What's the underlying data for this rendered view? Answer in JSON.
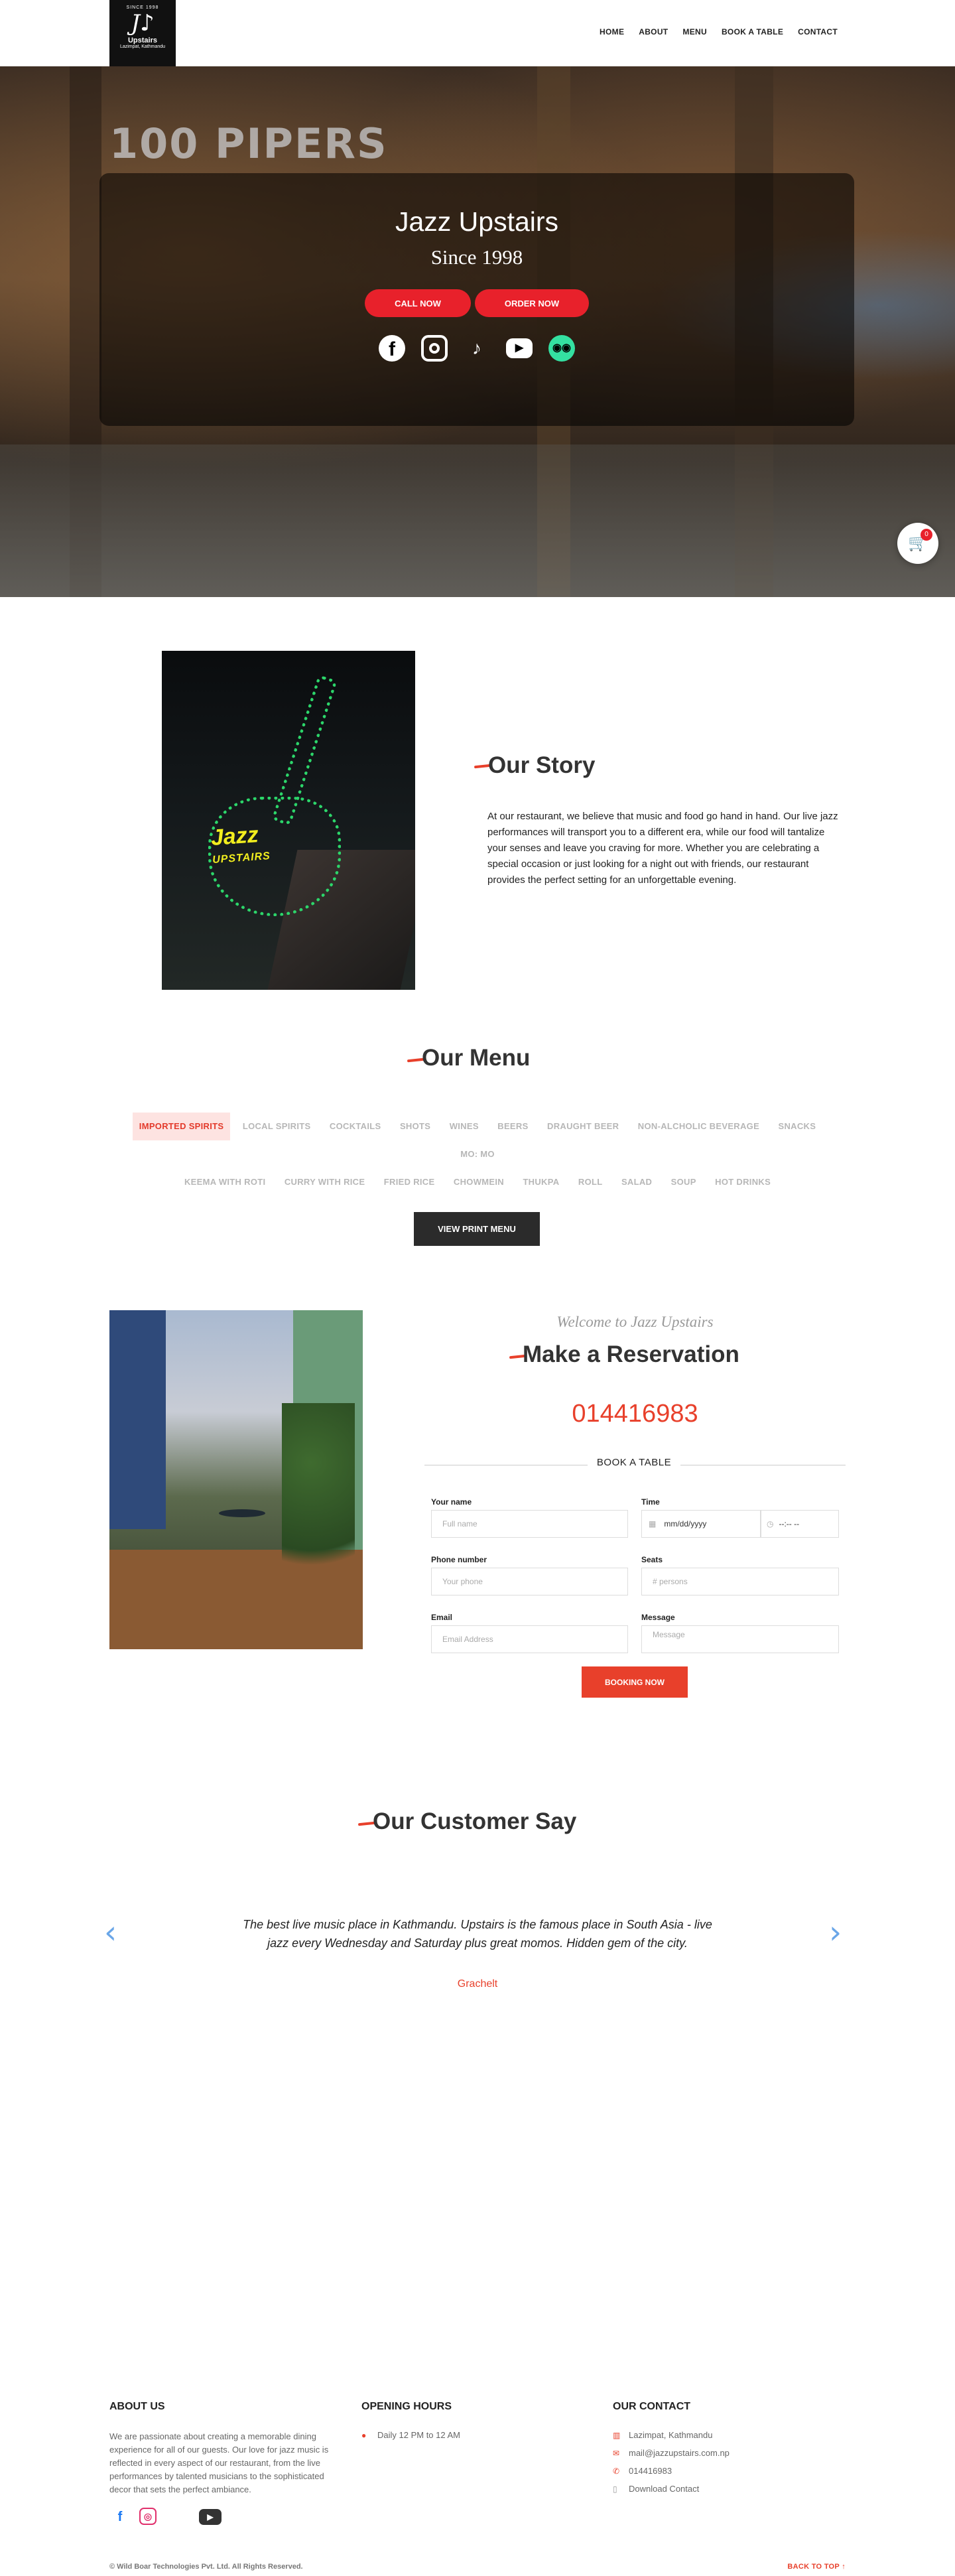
{
  "header": {
    "logo": {
      "since": "SINCE 1998",
      "brand": "Upstairs",
      "place": "Lazimpat, Kathmandu"
    },
    "nav": [
      "HOME",
      "ABOUT",
      "MENU",
      "BOOK A TABLE",
      "CONTACT"
    ]
  },
  "hero": {
    "bg_text": "100 PIPERS",
    "title": "Jazz Upstairs",
    "subtitle": "Since 1998",
    "call_label": "CALL NOW",
    "order_label": "ORDER NOW",
    "socials": [
      "facebook-icon",
      "instagram-icon",
      "tiktok-icon",
      "youtube-icon",
      "tripadvisor-icon"
    ],
    "cart_count": "0"
  },
  "story": {
    "neon_big": "Jazz",
    "neon_small": "UPSTAIRS",
    "title": "Our Story",
    "text": "At our restaurant, we believe that music and food go hand in hand. Our live jazz performances will transport you to a different era, while our food will tantalize your senses and leave you craving for more. Whether you are celebrating a special occasion or just looking for a night out with friends, our restaurant provides the perfect setting for an unforgettable evening."
  },
  "menu": {
    "title": "Our Menu",
    "tabs_row1": [
      "IMPORTED SPIRITS",
      "LOCAL SPIRITS",
      "COCKTAILS",
      "SHOTS",
      "WINES",
      "BEERS",
      "DRAUGHT BEER",
      "NON-ALCHOLIC BEVERAGE",
      "SNACKS",
      "MO: MO"
    ],
    "tabs_row2": [
      "KEEMA WITH ROTI",
      "CURRY WITH RICE",
      "FRIED RICE",
      "CHOWMEIN",
      "THUKPA",
      "ROLL",
      "SALAD",
      "SOUP",
      "HOT DRINKS"
    ],
    "active_tab": "IMPORTED SPIRITS",
    "print_label": "VIEW PRINT MENU"
  },
  "reservation": {
    "welcome": "Welcome to Jazz Upstairs",
    "title": "Make a Reservation",
    "phone": "014416983",
    "book_label": "BOOK A TABLE",
    "fields": {
      "name_label": "Your name",
      "name_placeholder": "Full name",
      "time_label": "Time",
      "date_placeholder": "mm/dd/yyyy",
      "time_placeholder": "--:-- --",
      "phone_label": "Phone number",
      "phone_placeholder": "Your phone",
      "seats_label": "Seats",
      "seats_placeholder": "# persons",
      "email_label": "Email",
      "email_placeholder": "Email Address",
      "message_label": "Message",
      "message_placeholder": "Message"
    },
    "submit_label": "BOOKING NOW"
  },
  "testimonials": {
    "title": "Our Customer Say",
    "quote": "The best live music place in Kathmandu. Upstairs is the famous place in South Asia - live jazz every Wednesday and Saturday plus great momos. Hidden gem of the city.",
    "author": "Grachelt",
    "prev": "‹",
    "next": "›"
  },
  "footer": {
    "about_title": "ABOUT US",
    "about_text": "We are passionate about creating a memorable dining experience for all of our guests. Our love for jazz music is reflected in every aspect of our restaurant, from the live performances by talented musicians to the sophisticated decor that sets the perfect ambiance.",
    "hours_title": "OPENING HOURS",
    "hours": "Daily 12 PM to 12 AM",
    "contact_title": "OUR CONTACT",
    "address": "Lazimpat, Kathmandu",
    "email": "mail@jazzupstairs.com.np",
    "phone": "014416983",
    "download": "Download Contact",
    "copyright": "© Wild Boar Technologies Pvt. Ltd. All Rights Reserved.",
    "back_to_top": "BACK TO TOP ↑"
  },
  "colors": {
    "accent": "#e8402b",
    "hero_button": "#e8212b",
    "active_tab_bg": "#fde3e1"
  }
}
